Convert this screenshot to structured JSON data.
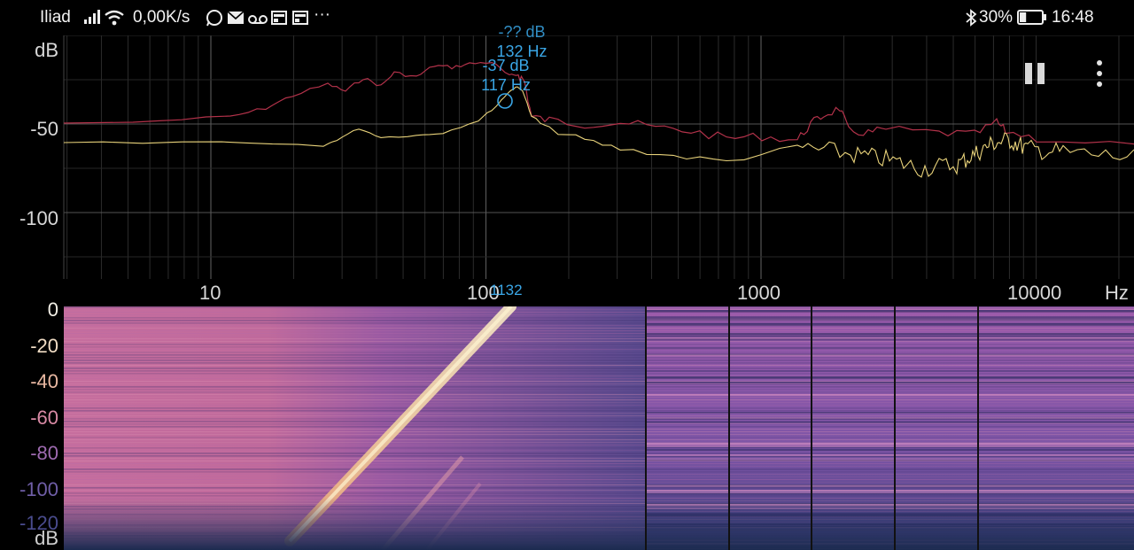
{
  "status_bar": {
    "carrier": "Iliad",
    "speed": "0,00K/s",
    "icons": [
      "signal-icon",
      "wifi-icon",
      "whatsapp-icon",
      "mail-icon",
      "voicemail-icon",
      "news-icon",
      "news-icon",
      "more-notifications-icon",
      "bluetooth-icon",
      "battery-icon"
    ],
    "more": "···",
    "battery_pct": "30%",
    "battery_level": 0.3,
    "time": "16:48"
  },
  "spectrum": {
    "y_unit": "dB",
    "y_ticks": [
      "-50",
      "-100"
    ],
    "x_unit": "Hz",
    "x_ticks": [
      "10",
      "100",
      "1000",
      "10000"
    ],
    "peak_marker_1": {
      "db": "-37 dB",
      "freq": "117 Hz"
    },
    "peak_marker_2": {
      "db": "-?? dB",
      "freq": "132 Hz"
    },
    "cursor_label": "1132",
    "colors": {
      "series_max": "#b3324a",
      "series_current": "#e8d27a",
      "marker": "#3aa6e6",
      "grid": "#3a3a3a"
    }
  },
  "controls": {
    "pause": "pause-icon",
    "menu": "more-vert-icon"
  },
  "spectrogram": {
    "y_ticks": [
      "0",
      "-20",
      "-40",
      "-60",
      "-80",
      "-100",
      "-120"
    ],
    "y_unit": "dB",
    "colors": {
      "low": "#2a2a5a",
      "mid": "#a25aa8",
      "high": "#f4e3a8"
    }
  }
}
